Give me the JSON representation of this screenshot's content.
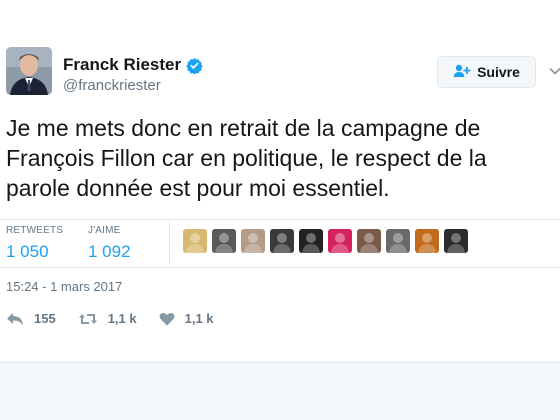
{
  "author": {
    "name": "Franck Riester",
    "handle": "@franckriester"
  },
  "follow_button": {
    "label": "Suivre"
  },
  "tweet": {
    "lines": [
      "Je me mets donc en retrait de la campagne de",
      "François Fillon car en politique, le respect de la",
      "parole donnée est pour moi essentiel."
    ]
  },
  "stats": {
    "retweets_label": "RETWEETS",
    "retweets_value": "1 050",
    "likes_label": "J'AIME",
    "likes_value": "1 092"
  },
  "liker_avatars": [
    {
      "name": "liker-1",
      "color": "#d8b870"
    },
    {
      "name": "liker-2",
      "color": "#5a5a5a"
    },
    {
      "name": "liker-3",
      "color": "#b59b87"
    },
    {
      "name": "liker-4",
      "color": "#3a3a3a"
    },
    {
      "name": "liker-5",
      "color": "#222222"
    },
    {
      "name": "liker-6",
      "color": "#d4245e"
    },
    {
      "name": "liker-7",
      "color": "#7a5a4a"
    },
    {
      "name": "liker-8",
      "color": "#6a6a6a"
    },
    {
      "name": "liker-9",
      "color": "#c06a1a"
    },
    {
      "name": "liker-10",
      "color": "#2b2b2b"
    }
  ],
  "timestamp": "15:24 - 1 mars 2017",
  "actions": {
    "reply_count": "155",
    "retweet_count": "1,1 k",
    "like_count": "1,1 k"
  },
  "colors": {
    "accent": "#1da1f2",
    "verified": "#1da1f2",
    "muted": "#657786"
  }
}
